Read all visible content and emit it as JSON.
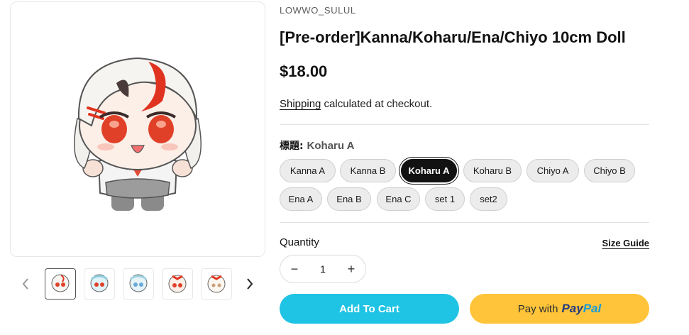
{
  "gallery": {
    "main_image": "chibi-doll-koharu-image",
    "prev_icon": "chevron-left-icon",
    "next_icon": "chevron-right-icon",
    "thumbnails": [
      {
        "name": "thumb-1",
        "active": true
      },
      {
        "name": "thumb-2",
        "active": false
      },
      {
        "name": "thumb-3",
        "active": false
      },
      {
        "name": "thumb-4",
        "active": false
      },
      {
        "name": "thumb-5",
        "active": false
      }
    ]
  },
  "product": {
    "vendor": "LOWWO_SULUL",
    "title": "[Pre-order]Kanna/Koharu/Ena/Chiyo 10cm Doll",
    "price": "$18.00",
    "shipping_link": "Shipping",
    "shipping_text": " calculated at checkout."
  },
  "option": {
    "label": "標題:",
    "selected_value": "Koharu A",
    "values": [
      "Kanna A",
      "Kanna B",
      "Koharu A",
      "Koharu B",
      "Chiyo A",
      "Chiyo B",
      "Ena A",
      "Ena B",
      "Ena C",
      "set 1",
      "set2"
    ]
  },
  "quantity": {
    "label": "Quantity",
    "value": "1",
    "minus": "−",
    "plus": "+",
    "size_guide": "Size Guide"
  },
  "buttons": {
    "add_to_cart": "Add To Cart",
    "paypal_prefix": "Pay with",
    "paypal_brand_1": "Pay",
    "paypal_brand_2": "Pal"
  },
  "colors": {
    "accent_cart": "#1fc3e3",
    "paypal_yellow": "#ffc439",
    "selected_pill": "#121212"
  }
}
